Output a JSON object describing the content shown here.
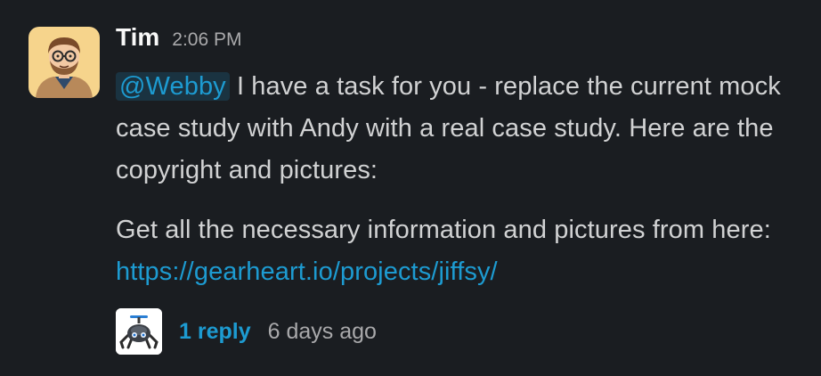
{
  "message": {
    "author": "Tim",
    "timestamp": "2:06 PM",
    "mention": "@Webby",
    "paragraph1_text": " I have a task for you - replace the current mock case study with Andy with a real case study. Here are the copyright and pictures:",
    "paragraph2_text": "Get all the necessary information and pictures from here: ",
    "link": "https://gearheart.io/projects/jiffsy/"
  },
  "thread": {
    "reply_count": "1 reply",
    "last_reply": "6 days ago"
  },
  "colors": {
    "background": "#1a1d21",
    "text": "#d1d2d3",
    "link": "#1d9bd1",
    "muted": "#a9a9ab",
    "author": "#f8f8f8"
  },
  "icons": {
    "author_avatar": "cartoon-avatar-icon",
    "reply_avatar": "robot-spider-icon"
  }
}
